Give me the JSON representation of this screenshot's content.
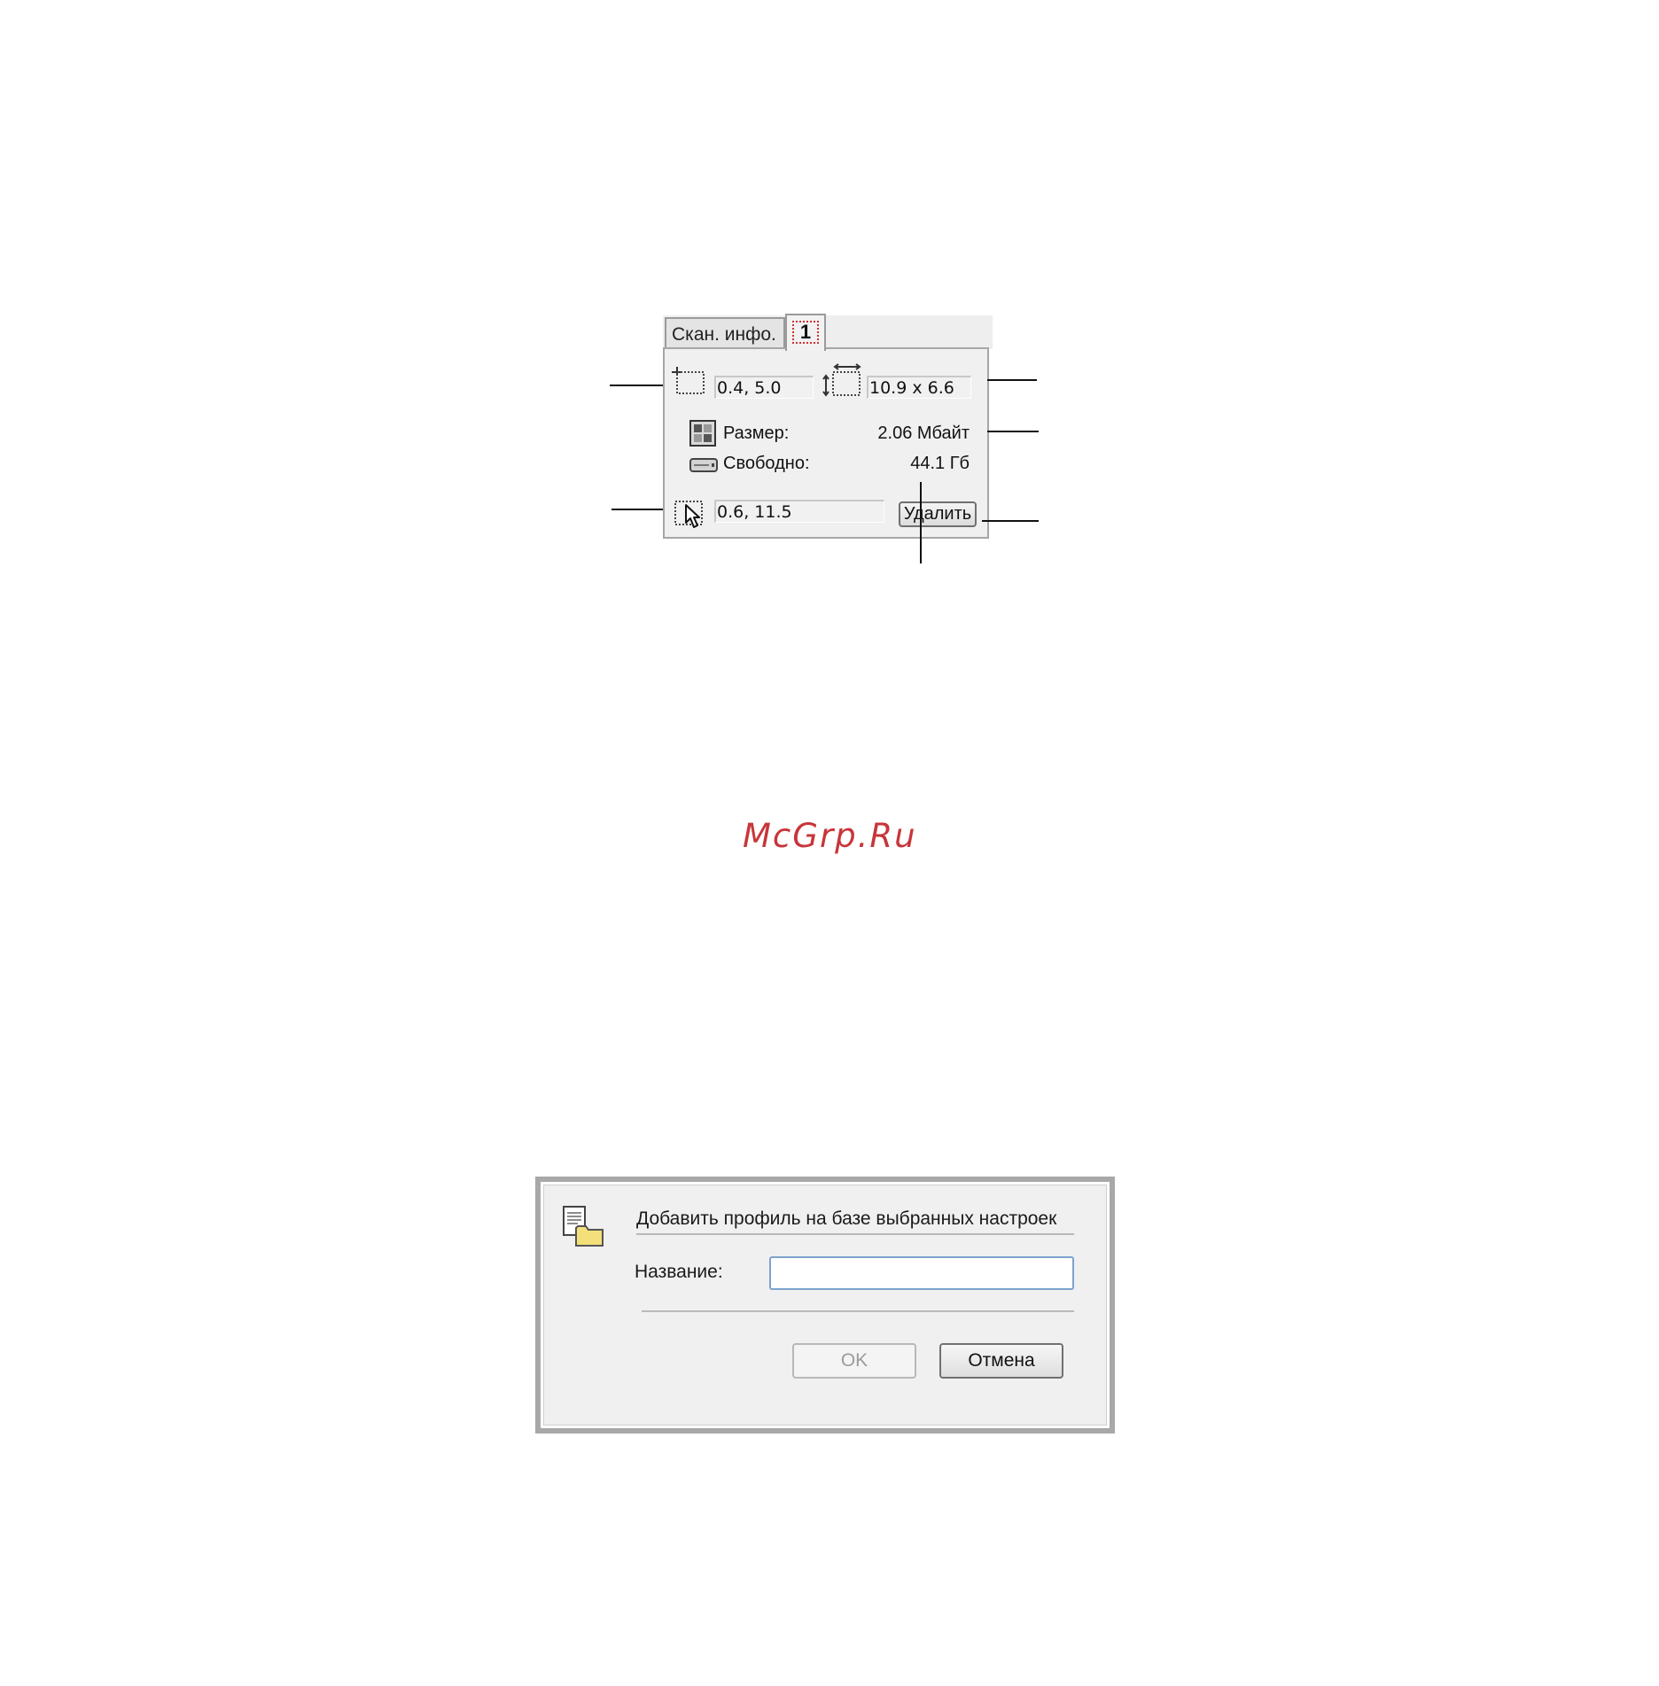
{
  "scan_info": {
    "tab_label": "Скан. инфо.",
    "tab_number": "1",
    "position_value": "0.4, 5.0",
    "dimensions_value": "10.9 x 6.6",
    "size_label": "Размер:",
    "size_value": "2.06 Мбайт",
    "free_label": "Свободно:",
    "free_value": "44.1 Гб",
    "cursor_value": "0.6, 11.5",
    "delete_label": "Удалить",
    "icons": [
      "selection-origin-icon",
      "selection-size-icon",
      "image-size-icon",
      "disk-drive-icon",
      "cursor-position-icon"
    ]
  },
  "watermark": "McGrp.Ru",
  "add_profile_dialog": {
    "title": "Добавить профиль на базе выбранных настроек",
    "name_label": "Название:",
    "name_value": "",
    "ok_label": "OK",
    "cancel_label": "Отмена",
    "icon": "profile-folder-icon"
  },
  "colors": {
    "watermark": "#c8353a",
    "focus_rect": "#d03030",
    "input_border": "#7da2ce"
  }
}
